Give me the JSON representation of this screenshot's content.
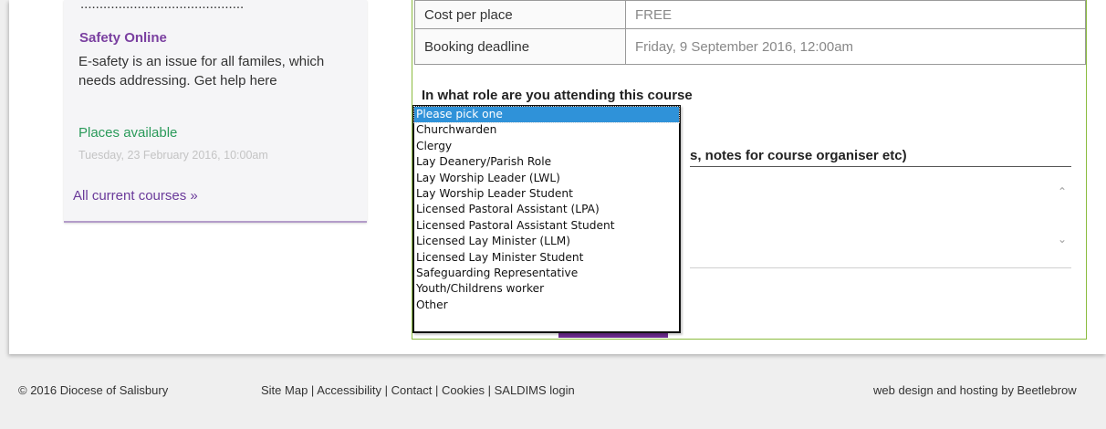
{
  "course_card": {
    "cut_text": "...........................................",
    "title": "Safety Online",
    "description": "E-safety is an issue for all familes, which needs addressing. Get help here",
    "availability": "Places available",
    "date": "Tuesday, 23 February 2016, 10:00am",
    "all_courses_link": "All current courses »"
  },
  "booking": {
    "rows": [
      {
        "label": "Cost per place",
        "value": "FREE"
      },
      {
        "label": "Booking deadline",
        "value": "Friday, 9 September 2016, 12:00am"
      }
    ],
    "role_label": "In what role are you attending this course",
    "notes_label": "s, notes for course organiser etc)"
  },
  "role_dropdown": {
    "options": [
      "Please pick one",
      "Churchwarden",
      "Clergy",
      "Lay Deanery/Parish Role",
      "Lay Worship Leader (LWL)",
      "Lay Worship Leader Student",
      "Licensed Pastoral Assistant (LPA)",
      "Licensed Pastoral Assistant Student",
      "Licensed Lay Minister (LLM)",
      "Licensed Lay Minister Student",
      "Safeguarding Representative",
      "Youth/Childrens worker",
      "Other"
    ],
    "selected_index": 0
  },
  "footer": {
    "copyright": "© 2016 Diocese of Salisbury",
    "links": [
      "Site Map",
      "Accessibility",
      "Contact",
      "Cookies",
      "SALDIMS login"
    ],
    "separator": " | ",
    "credit": "web design and hosting by Beetlebrow"
  },
  "icons": {
    "scroll_up": "chevron-up-icon",
    "scroll_down": "chevron-down-icon"
  },
  "colors": {
    "accent_purple": "#7a3fa0",
    "available_green": "#2a9a5a",
    "panel_border": "#8bbc3f",
    "selected_option": "#2f92d9"
  }
}
